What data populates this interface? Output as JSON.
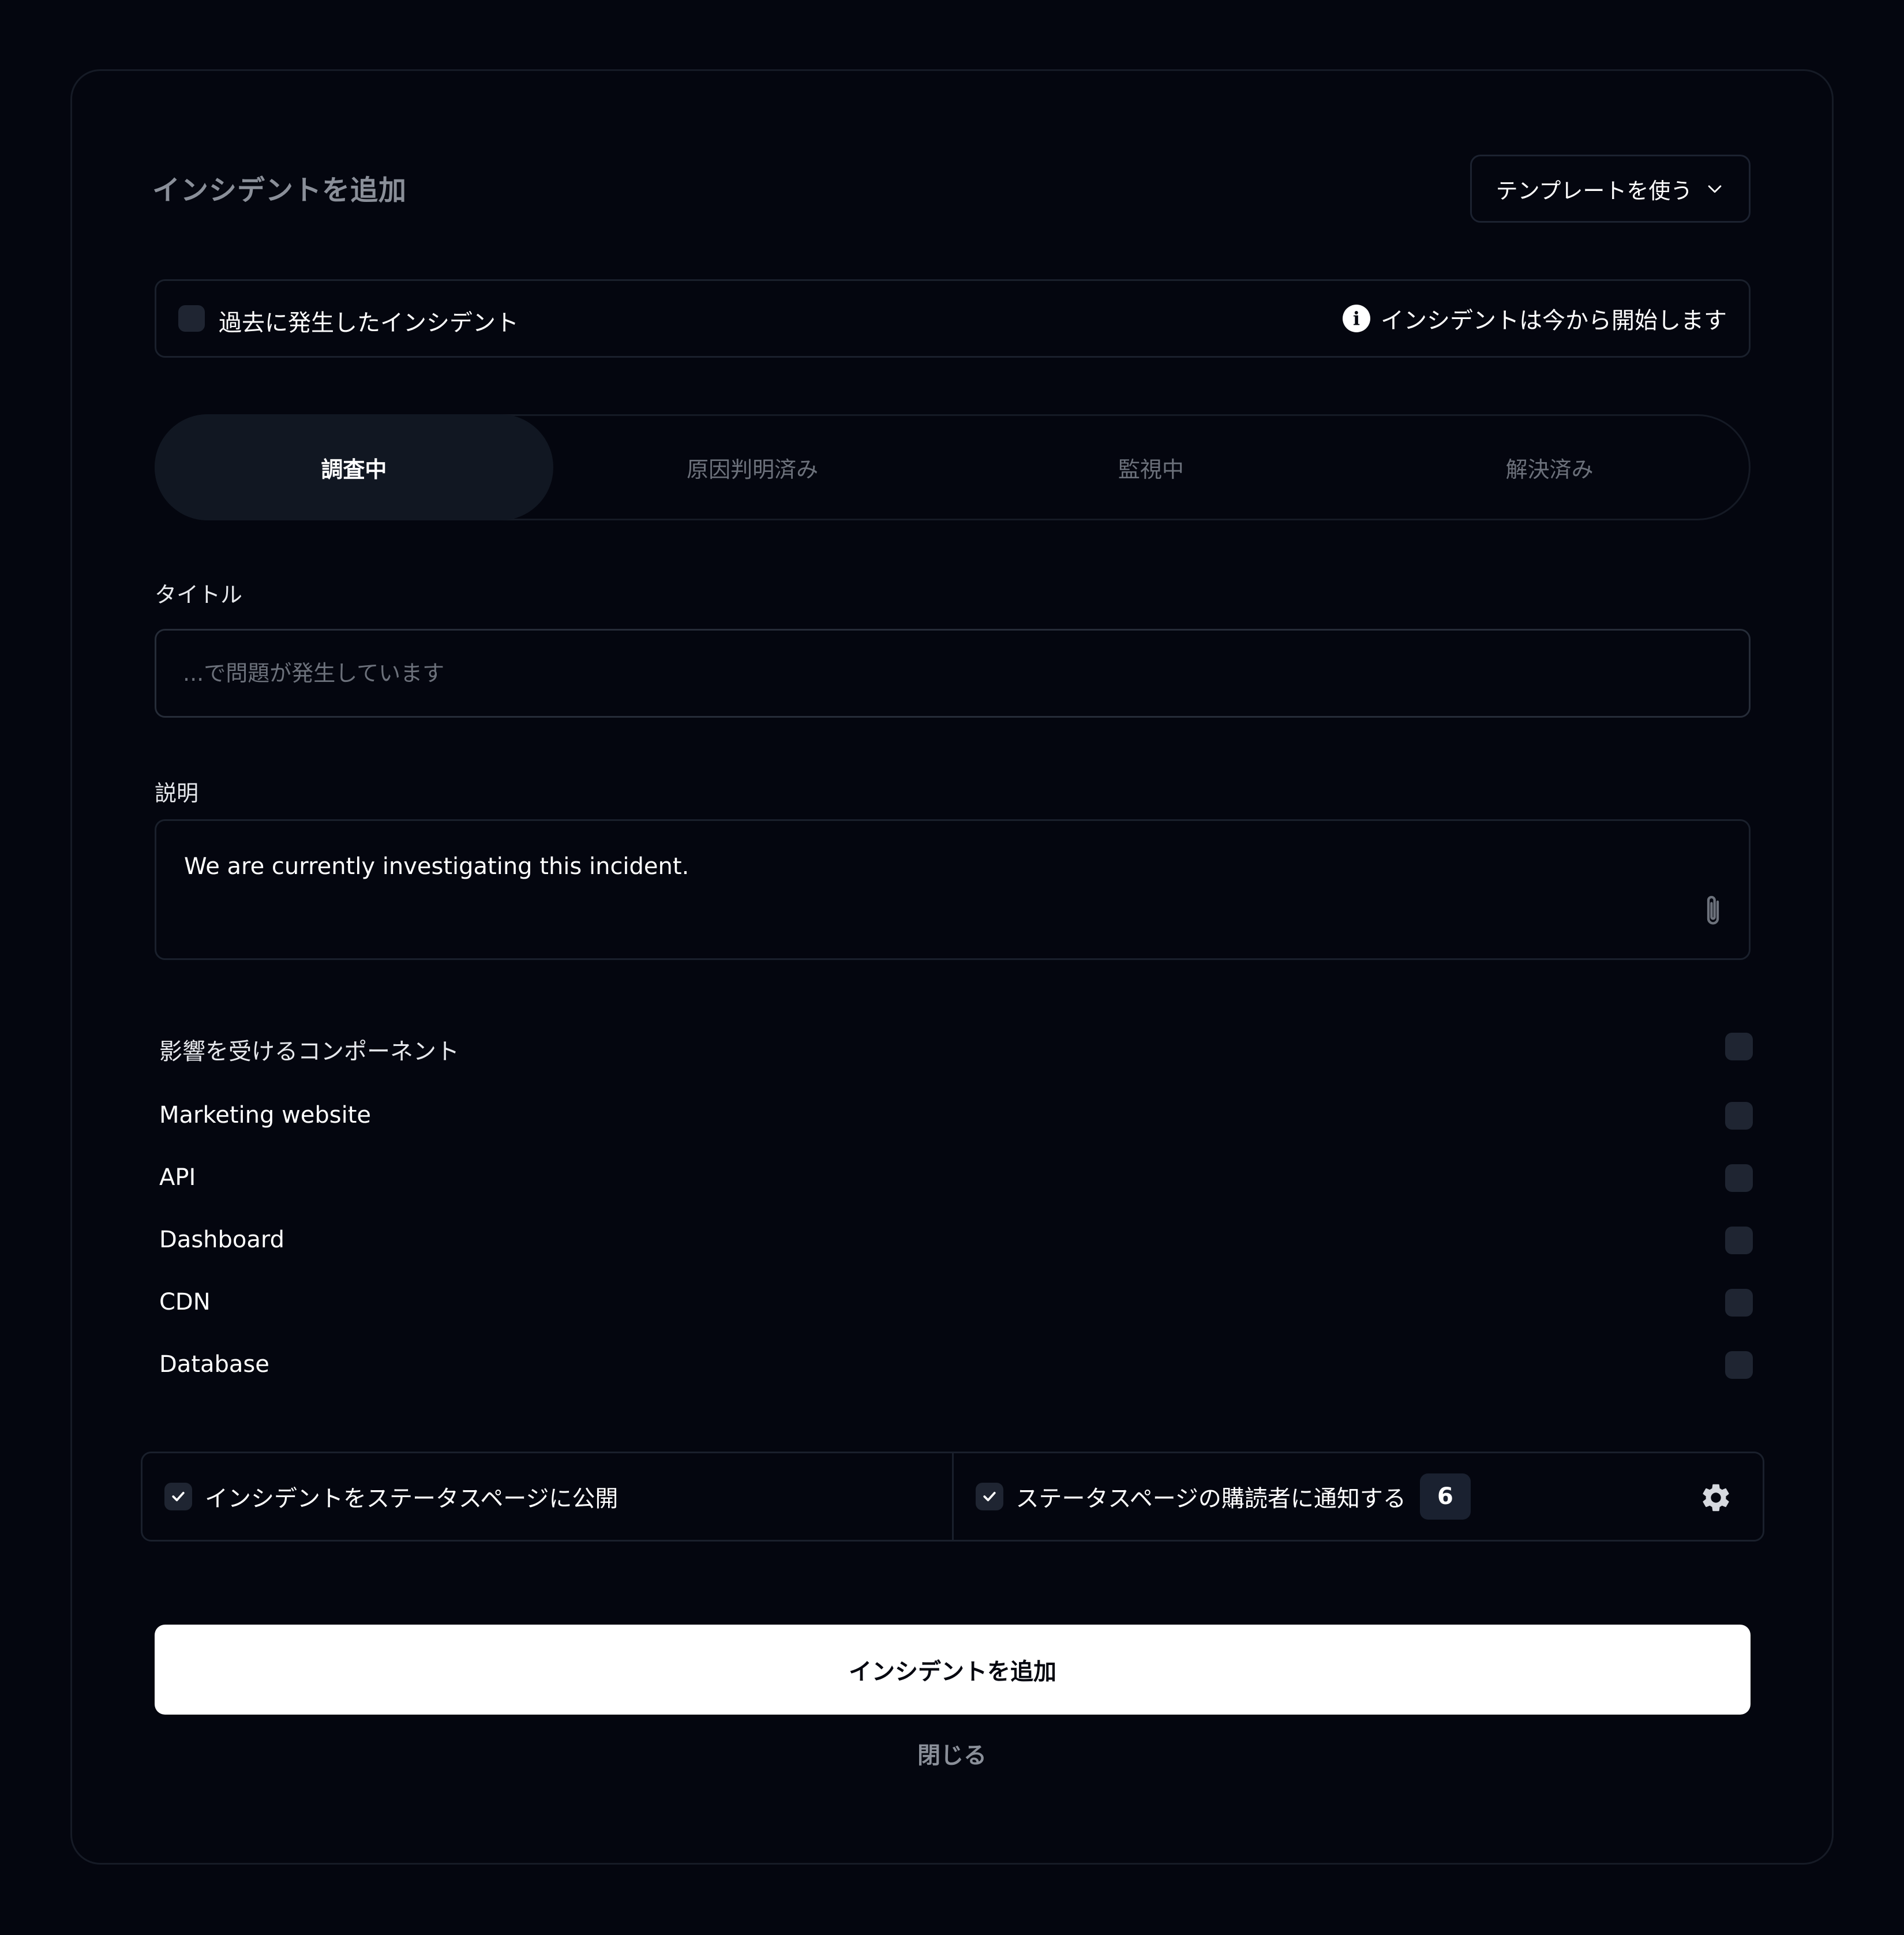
{
  "dialog": {
    "title": "インシデントを追加",
    "template_button": "テンプレートを使う"
  },
  "past_incident": {
    "label": "過去に発生したインシデント",
    "checked": false,
    "info_text": "インシデントは今から開始します"
  },
  "status_tabs": [
    {
      "label": "調査中",
      "active": true
    },
    {
      "label": "原因判明済み",
      "active": false
    },
    {
      "label": "監視中",
      "active": false
    },
    {
      "label": "解決済み",
      "active": false
    }
  ],
  "title_field": {
    "label": "タイトル",
    "placeholder": "...で問題が発生しています",
    "value": ""
  },
  "description_field": {
    "label": "説明",
    "value": "We are currently investigating this incident."
  },
  "components": {
    "header": "影響を受けるコンポーネント",
    "items": [
      {
        "label": "Marketing website",
        "checked": false
      },
      {
        "label": "API",
        "checked": false
      },
      {
        "label": "Dashboard",
        "checked": false
      },
      {
        "label": "CDN",
        "checked": false
      },
      {
        "label": "Database",
        "checked": false
      }
    ]
  },
  "options": {
    "publish_label": "インシデントをステータスページに公開",
    "publish_checked": true,
    "notify_label": "ステータスページの購読者に通知する",
    "notify_checked": true,
    "subscriber_count": "6"
  },
  "actions": {
    "submit_label": "インシデントを追加",
    "close_label": "閉じる"
  },
  "colors": {
    "background": "#04060f",
    "border": "#1a202c",
    "muted_text": "#8a8f99",
    "checkbox_bg": "#1f2532",
    "primary_button": "#ffffff"
  }
}
